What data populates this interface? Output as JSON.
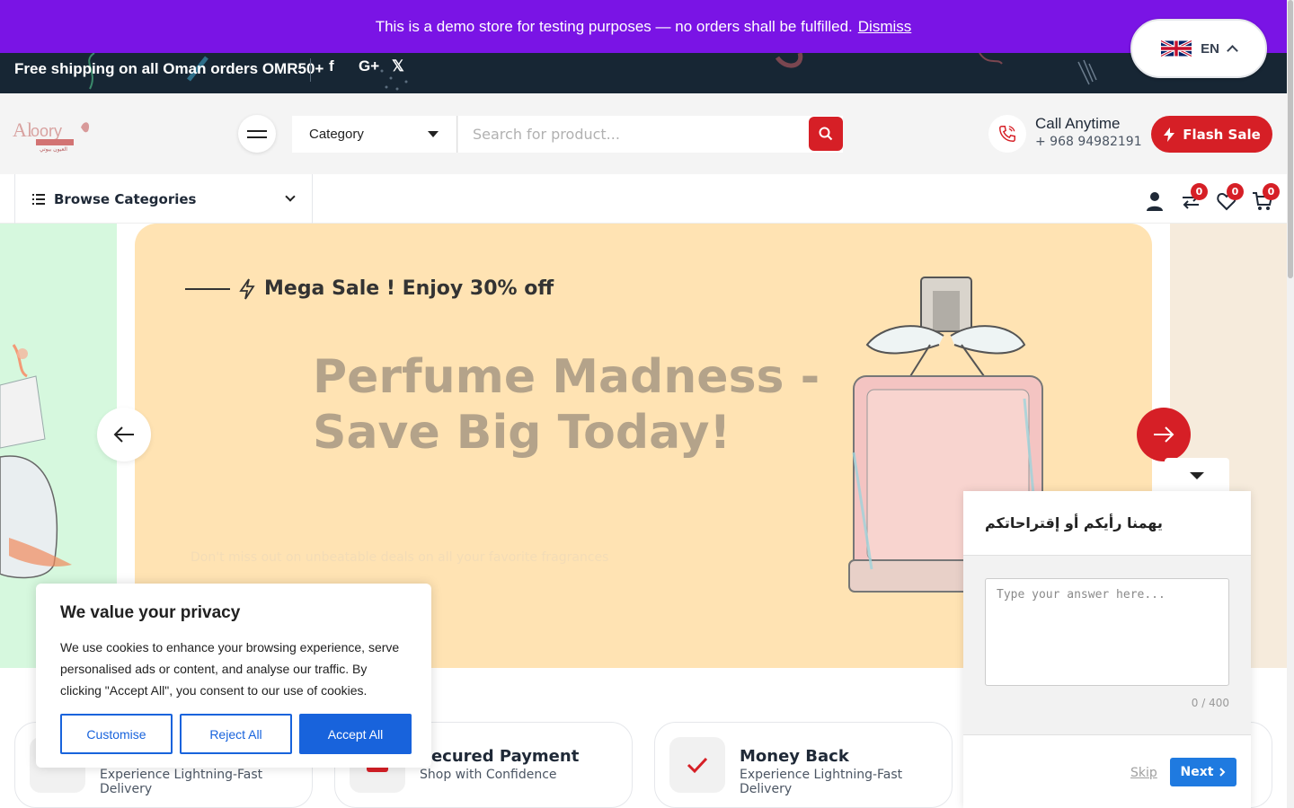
{
  "demo_banner": {
    "text": "This is a demo store for testing purposes — no orders shall be fulfilled.",
    "dismiss": "Dismiss"
  },
  "language": {
    "code": "EN",
    "flag_icon": "uk-flag-icon"
  },
  "top_strip": {
    "shipping": "Free shipping on all Oman orders OMR50+",
    "social": [
      "facebook-icon",
      "google-plus-icon",
      "x-icon"
    ]
  },
  "header": {
    "category_label": "Category",
    "search_placeholder": "Search for product...",
    "call_title": "Call Anytime",
    "call_number": "+ 968 94982191",
    "flash_sale": "Flash Sale"
  },
  "navbar": {
    "browse": "Browse Categories",
    "badges": {
      "compare": "0",
      "wishlist": "0",
      "cart": "0"
    }
  },
  "hero": {
    "eyebrow": "Mega Sale ! Enjoy 30% off",
    "title_line1": "Perfume Madness -",
    "title_line2": "Save Big Today!",
    "subtitle": "Don't miss out on unbeatable deals on all your favorite fragrances"
  },
  "features": [
    {
      "title": "",
      "subtitle": "Experience Lightning-Fast Delivery"
    },
    {
      "title": "Secured Payment",
      "subtitle": "Shop with Confidence"
    },
    {
      "title": "Money Back",
      "subtitle": "Experience Lightning-Fast Delivery"
    }
  ],
  "cookie": {
    "title": "We value your privacy",
    "text": "We use cookies to enhance your browsing experience, serve personalised ads or content, and analyse our traffic. By clicking \"Accept All\", you consent to our use of cookies.",
    "customise": "Customise",
    "reject": "Reject All",
    "accept": "Accept All"
  },
  "feedback": {
    "title": "يهمنا رأيكم أو إقتراحاتكم",
    "placeholder": "Type your answer here...",
    "count": "0 / 400",
    "skip": "Skip",
    "next": "Next"
  },
  "colors": {
    "brand_red": "#d61f26",
    "banner_purple": "#7a14e5",
    "strip_navy": "#172634",
    "cookie_blue": "#1863dc"
  }
}
